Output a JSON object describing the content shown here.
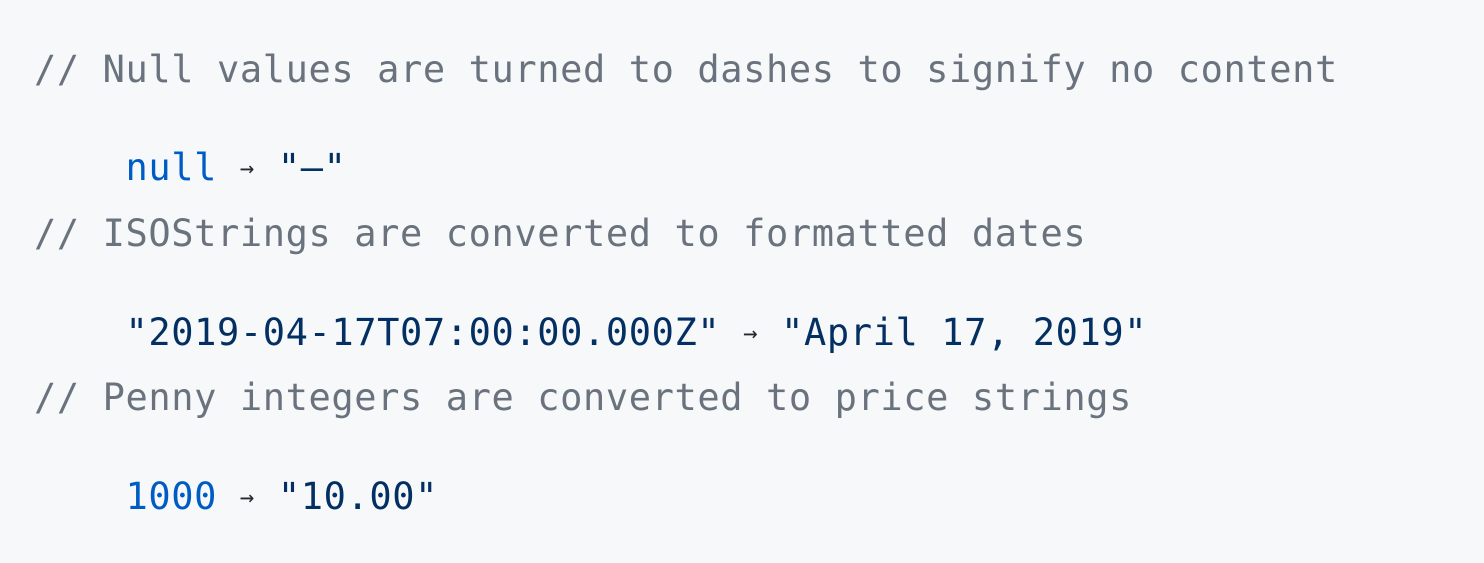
{
  "code": {
    "examples": [
      {
        "comment": "// Null values are turned to dashes to signify no content",
        "input": "null",
        "arrow": "→",
        "output": "\"–\""
      },
      {
        "comment": "// ISOStrings are converted to formatted dates",
        "input": "\"2019-04-17T07:00:00.000Z\"",
        "arrow": "→",
        "output": "\"April 17, 2019\""
      },
      {
        "comment": "// Penny integers are converted to price strings",
        "input": "1000",
        "arrow": "→",
        "output": "\"10.00\""
      }
    ]
  },
  "colors": {
    "background": "#f6f8fa",
    "comment": "#6a737d",
    "keyword_number": "#005cc5",
    "string": "#032f62",
    "arrow": "#24292e"
  }
}
